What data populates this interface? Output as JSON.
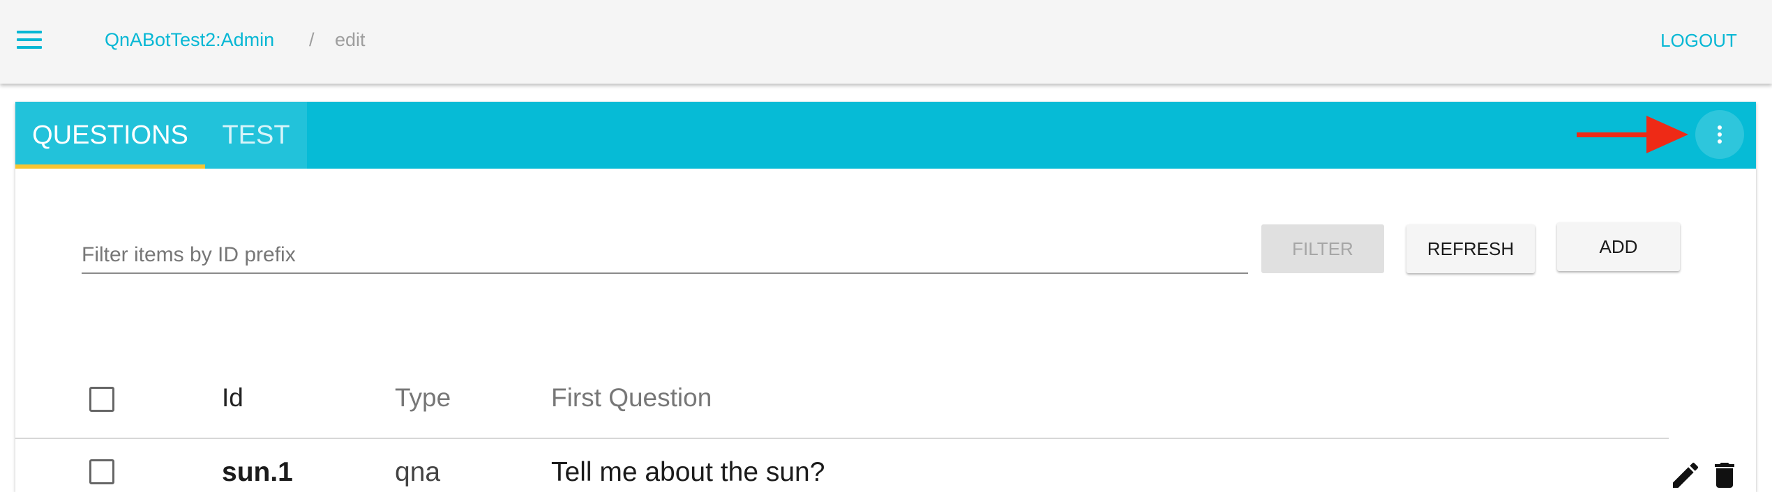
{
  "header": {
    "menu_icon": "menu-icon",
    "breadcrumb_root": "QnABotTest2:Admin",
    "breadcrumb_separator": "/",
    "breadcrumb_current": "edit",
    "logout_label": "LOGOUT",
    "accent_color": "#06b7d4"
  },
  "tabs": [
    {
      "label": "QUESTIONS",
      "active": true
    },
    {
      "label": "TEST",
      "active": false
    }
  ],
  "tabbar": {
    "background": "#06bbd6",
    "indicator_color": "#f7c531",
    "more_icon": "more-vert-icon",
    "annotation_icon": "red-arrow-icon"
  },
  "filter": {
    "placeholder": "Filter items by ID prefix",
    "value": ""
  },
  "buttons": {
    "filter": "FILTER",
    "refresh": "REFRESH",
    "add": "ADD"
  },
  "table": {
    "columns": [
      "Id",
      "Type",
      "First Question"
    ],
    "rows": [
      {
        "id": "sun.1",
        "type": "qna",
        "first_question": "Tell me about the sun?",
        "checked": false
      }
    ],
    "row_actions": [
      "edit-icon",
      "delete-icon"
    ]
  }
}
